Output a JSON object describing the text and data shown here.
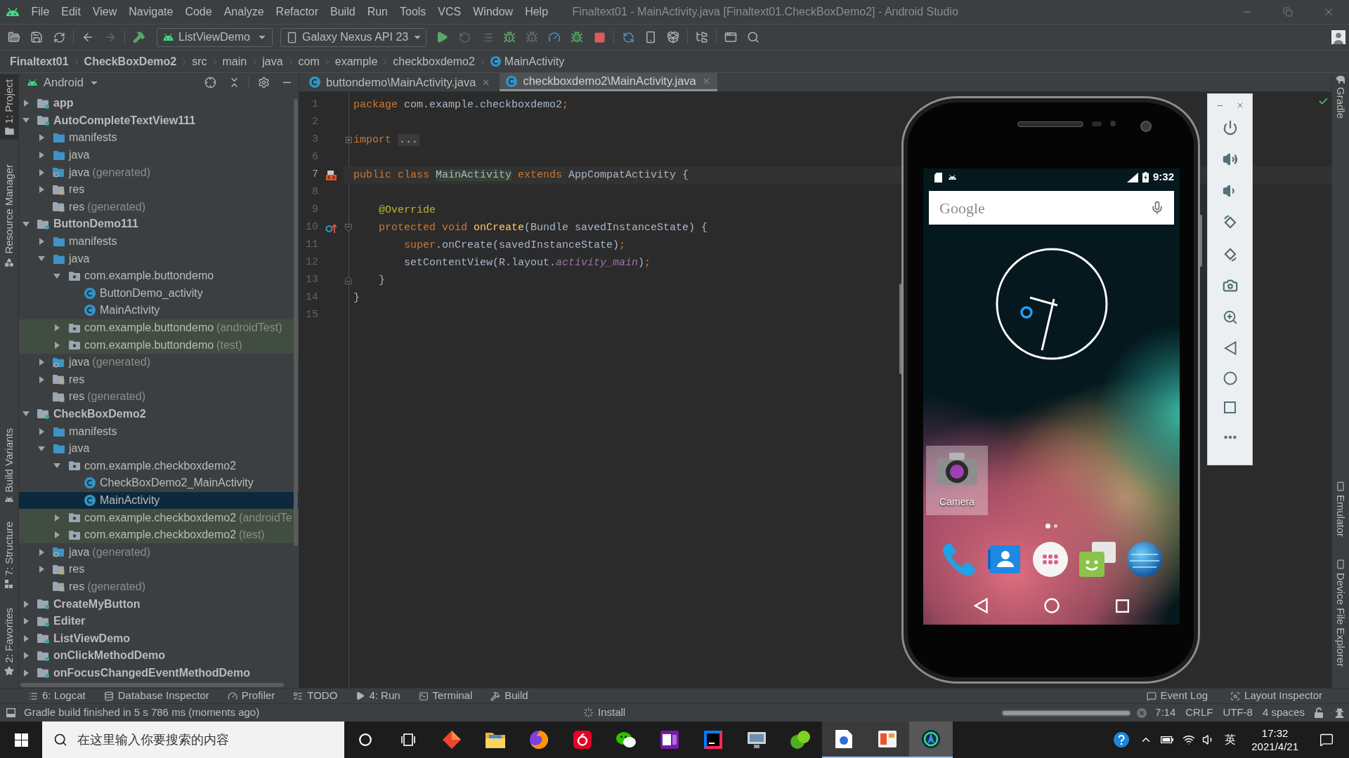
{
  "window": {
    "title": "Finaltext01 - MainActivity.java [Finaltext01.CheckBoxDemo2] - Android Studio"
  },
  "menu": [
    "File",
    "Edit",
    "View",
    "Navigate",
    "Code",
    "Analyze",
    "Refactor",
    "Build",
    "Run",
    "Tools",
    "VCS",
    "Window",
    "Help"
  ],
  "toolbar": {
    "run_config": "ListViewDemo",
    "device": "Galaxy Nexus API 23"
  },
  "breadcrumb": [
    {
      "label": "Finaltext01",
      "kind": "module"
    },
    {
      "label": "CheckBoxDemo2",
      "kind": "module"
    },
    {
      "label": "src",
      "kind": "dir"
    },
    {
      "label": "main",
      "kind": "dir"
    },
    {
      "label": "java",
      "kind": "dir"
    },
    {
      "label": "com",
      "kind": "dir"
    },
    {
      "label": "example",
      "kind": "dir"
    },
    {
      "label": "checkboxdemo2",
      "kind": "dir"
    },
    {
      "label": "MainActivity",
      "kind": "class"
    }
  ],
  "left_strip": [
    {
      "label": "1: Project",
      "selected": true
    },
    {
      "label": "Resource Manager",
      "selected": false
    },
    {
      "label": "Build Variants",
      "selected": false
    },
    {
      "label": "7: Structure",
      "selected": false
    },
    {
      "label": "2: Favorites",
      "selected": false
    }
  ],
  "project": {
    "view": "Android",
    "tree": [
      {
        "label": "app",
        "kind": "module",
        "expanded": false,
        "selected": false
      },
      {
        "label": "AutoCompleteTextView111",
        "kind": "module",
        "expanded": true,
        "selected": false,
        "children": [
          {
            "label": "manifests",
            "kind": "folder",
            "expanded": false,
            "selected": false
          },
          {
            "label": "java",
            "kind": "folder",
            "expanded": false,
            "selected": false
          },
          {
            "label": "java",
            "note": "(generated)",
            "kind": "generated_folder",
            "expanded": false,
            "selected": false
          },
          {
            "label": "res",
            "kind": "res_folder",
            "expanded": false,
            "selected": false
          },
          {
            "label": "res",
            "note": "(generated)",
            "kind": "res_folder",
            "selected": false
          }
        ]
      },
      {
        "label": "ButtonDemo111",
        "kind": "module",
        "expanded": true,
        "selected": false,
        "children": [
          {
            "label": "manifests",
            "kind": "folder",
            "expanded": false,
            "selected": false
          },
          {
            "label": "java",
            "kind": "folder",
            "expanded": true,
            "selected": false,
            "children": [
              {
                "label": "com.example.buttondemo",
                "kind": "package",
                "expanded": true,
                "selected": false,
                "children": [
                  {
                    "label": "ButtonDemo_activity",
                    "kind": "class",
                    "selected": false
                  },
                  {
                    "label": "MainActivity",
                    "kind": "class",
                    "selected": false
                  }
                ]
              },
              {
                "label": "com.example.buttondemo",
                "note": "(androidTest)",
                "kind": "test_package",
                "expanded": false,
                "selected": false
              },
              {
                "label": "com.example.buttondemo",
                "note": "(test)",
                "kind": "test_package",
                "expanded": false,
                "selected": false
              }
            ]
          },
          {
            "label": "java",
            "note": "(generated)",
            "kind": "generated_folder",
            "expanded": false,
            "selected": false
          },
          {
            "label": "res",
            "kind": "res_folder",
            "expanded": false,
            "selected": false
          },
          {
            "label": "res",
            "note": "(generated)",
            "kind": "res_folder",
            "selected": false
          }
        ]
      },
      {
        "label": "CheckBoxDemo2",
        "kind": "module",
        "expanded": true,
        "selected": false,
        "children": [
          {
            "label": "manifests",
            "kind": "folder",
            "expanded": false,
            "selected": false
          },
          {
            "label": "java",
            "kind": "folder",
            "expanded": true,
            "selected": false,
            "children": [
              {
                "label": "com.example.checkboxdemo2",
                "kind": "package",
                "expanded": true,
                "selected": false,
                "children": [
                  {
                    "label": "CheckBoxDemo2_MainActivity",
                    "kind": "class",
                    "selected": false
                  },
                  {
                    "label": "MainActivity",
                    "kind": "class",
                    "selected": true
                  }
                ]
              },
              {
                "label": "com.example.checkboxdemo2",
                "note": "(androidTe",
                "kind": "test_package",
                "expanded": false,
                "selected": false
              },
              {
                "label": "com.example.checkboxdemo2",
                "note": "(test)",
                "kind": "test_package",
                "expanded": false,
                "selected": false
              }
            ]
          },
          {
            "label": "java",
            "note": "(generated)",
            "kind": "generated_folder",
            "expanded": false,
            "selected": false
          },
          {
            "label": "res",
            "kind": "res_folder",
            "expanded": false,
            "selected": false
          },
          {
            "label": "res",
            "note": "(generated)",
            "kind": "res_folder",
            "selected": false
          }
        ]
      },
      {
        "label": "CreateMyButton",
        "kind": "module",
        "expanded": false,
        "selected": false
      },
      {
        "label": "Editer",
        "kind": "module",
        "expanded": false,
        "selected": false
      },
      {
        "label": "ListViewDemo",
        "kind": "module",
        "expanded": false,
        "selected": false
      },
      {
        "label": "onClickMethodDemo",
        "kind": "module",
        "expanded": false,
        "selected": false
      },
      {
        "label": "onFocusChangedEventMethodDemo",
        "kind": "module",
        "expanded": false,
        "selected": false
      }
    ]
  },
  "editor": {
    "tabs": [
      {
        "label": "buttondemo\\MainActivity.java",
        "selected": false
      },
      {
        "label": "checkboxdemo2\\MainActivity.java",
        "selected": true
      }
    ],
    "lines": [
      {
        "number": "1",
        "tokens": [
          {
            "text": "package",
            "kind": "keyword"
          },
          {
            "text": " com.example.checkboxdemo2",
            "kind": "plain"
          },
          {
            "text": ";",
            "kind": "keyword"
          }
        ]
      },
      {
        "number": "2"
      },
      {
        "number": "3",
        "fold": {
          "kind": "expand"
        },
        "tokens": [
          {
            "text": "import",
            "kind": "keyword"
          },
          {
            "text": "...",
            "kind": "folded"
          }
        ]
      },
      {
        "number": "6"
      },
      {
        "number": "7",
        "current": true,
        "marker": {
          "kind": "layout"
        },
        "tokens": [
          {
            "text": "public class ",
            "kind": "keyword"
          },
          {
            "text": "MainActivity",
            "kind": "usage"
          },
          {
            "text": " extends ",
            "kind": "keyword"
          },
          {
            "text": "AppCompatActivity {",
            "kind": "plain"
          }
        ]
      },
      {
        "number": "8"
      },
      {
        "number": "9",
        "tokens": [
          {
            "text": "    @Override",
            "kind": "annotation"
          }
        ]
      },
      {
        "number": "10",
        "marker": {
          "kind": "override"
        },
        "fold": {
          "kind": "collapse"
        },
        "tokens": [
          {
            "text": "    protected void ",
            "kind": "keyword"
          },
          {
            "text": "onCreate",
            "kind": "method"
          },
          {
            "text": "(Bundle savedInstanceState) {",
            "kind": "plain"
          }
        ]
      },
      {
        "number": "11",
        "tokens": [
          {
            "text": "        super",
            "kind": "keyword"
          },
          {
            "text": ".onCreate(savedInstanceState)",
            "kind": "plain"
          },
          {
            "text": ";",
            "kind": "keyword"
          }
        ]
      },
      {
        "number": "12",
        "tokens": [
          {
            "text": "        setContentView(R.layout.",
            "kind": "plain"
          },
          {
            "text": "activity_main",
            "kind": "field"
          },
          {
            "text": ")",
            "kind": "plain"
          },
          {
            "text": ";",
            "kind": "keyword"
          }
        ]
      },
      {
        "number": "13",
        "fold": {
          "kind": "end"
        },
        "tokens": [
          {
            "text": "    }",
            "kind": "plain"
          }
        ]
      },
      {
        "number": "14",
        "tokens": [
          {
            "text": "}",
            "kind": "plain"
          }
        ]
      },
      {
        "number": "15"
      }
    ]
  },
  "emulator": {
    "status_time": "9:32",
    "search_logo": "Google",
    "shortcuts": [
      {
        "label": "Camera",
        "selected": true
      }
    ],
    "page_dots": [
      {
        "selected": true
      },
      {
        "selected": false
      }
    ]
  },
  "right_strip": [
    "Gradle",
    "Emulator",
    "Device File Explorer"
  ],
  "tool_windows": {
    "left": [
      "6: Logcat",
      "Database Inspector",
      "Profiler",
      "TODO",
      "4: Run",
      "Terminal",
      "Build"
    ],
    "right": [
      "Event Log",
      "Layout Inspector"
    ]
  },
  "status_bar": {
    "message": "Gradle build finished in 5 s 786 ms (moments ago)",
    "task": "Install",
    "progress": {
      "level": 1
    },
    "position": "7:14",
    "line_separator": "CRLF",
    "encoding": "UTF-8",
    "indent": "4 spaces"
  },
  "taskbar": {
    "search": {
      "placeholder": "在这里输入你要搜索的内容"
    },
    "apps": [
      {
        "open": false,
        "selected": false
      },
      {
        "open": false,
        "selected": false
      },
      {
        "open": false,
        "selected": false
      },
      {
        "open": false,
        "selected": false
      },
      {
        "open": false,
        "selected": false
      },
      {
        "open": false,
        "selected": false
      },
      {
        "open": false,
        "selected": false
      },
      {
        "open": false,
        "selected": false
      },
      {
        "open": false,
        "selected": false
      },
      {
        "open": true,
        "selected": false
      },
      {
        "open": true,
        "selected": false
      },
      {
        "open": true,
        "selected": true
      }
    ],
    "ime": "英",
    "time": "17:32",
    "date": "2021/4/21"
  }
}
